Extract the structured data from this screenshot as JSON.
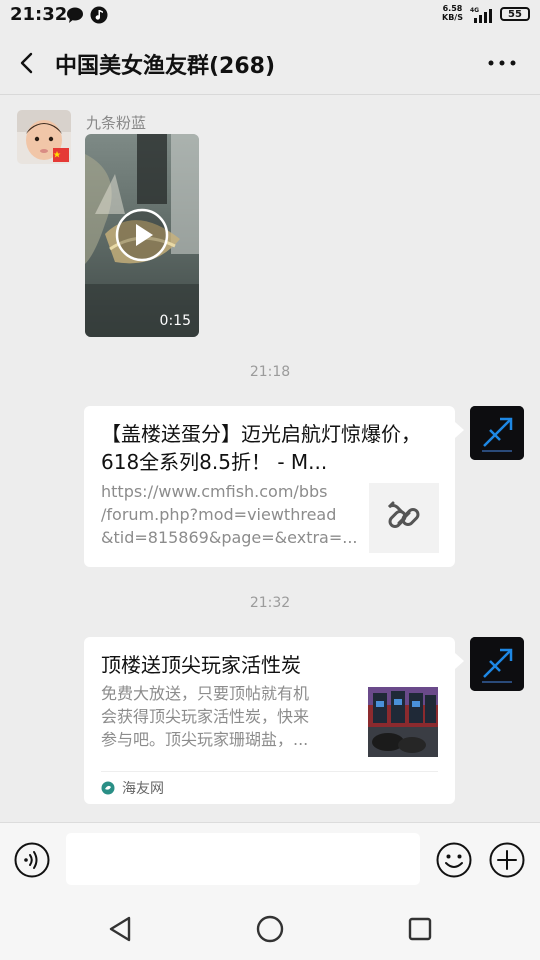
{
  "status_bar": {
    "time": "21:32",
    "speed_value": "6.58",
    "speed_unit": "KB/S",
    "network": "4G",
    "battery": "55"
  },
  "header": {
    "title": "中国美女渔友群(268)"
  },
  "messages": [
    {
      "type": "video",
      "sender": "九条粉蓝",
      "duration": "0:15"
    },
    {
      "type": "timestamp",
      "text": "21:18"
    },
    {
      "type": "link",
      "title": "【盖楼送蛋分】迈光启航灯惊爆价，618全系列8.5折！ - M...",
      "url_lines": [
        "https://www.cmfish.com/bbs",
        "/forum.php?mod=viewthread",
        "&tid=815869&page=&extra=..."
      ]
    },
    {
      "type": "timestamp",
      "text": "21:32"
    },
    {
      "type": "article",
      "title": "顶楼送顶尖玩家活性炭",
      "desc_lines": [
        "免费大放送，只要顶帖就有机",
        "会获得顶尖玩家活性炭，快来",
        "参与吧。顶尖玩家珊瑚盐，..."
      ],
      "source": "海友网"
    }
  ],
  "input": {
    "placeholder": ""
  },
  "colors": {
    "background": "#ededed",
    "card": "#ffffff",
    "muted_text": "#9b9b9b",
    "source_icon": "#2a8f86"
  }
}
